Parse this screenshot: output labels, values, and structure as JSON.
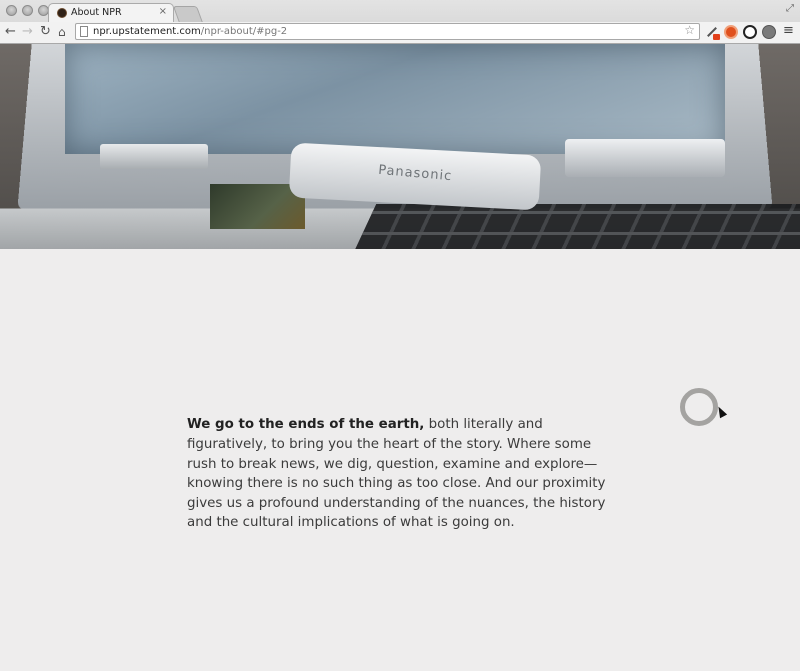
{
  "browser": {
    "tab_title": "About NPR",
    "tab_close": "×",
    "url_host": "npr.upstatement.com",
    "url_path": "/npr-about/#pg-2",
    "icons": {
      "back": "back-arrow-icon",
      "forward": "forward-arrow-icon",
      "reload": "reload-icon",
      "home": "home-icon",
      "star": "bookmark-star-icon",
      "menu": "menu-icon"
    },
    "glyphs": {
      "back": "←",
      "forward": "→",
      "reload": "↻",
      "home": "⌂",
      "star": "☆",
      "menu": "≡"
    }
  },
  "hero": {
    "brand_text": "Panasonic"
  },
  "content": {
    "lead_bold": "We go to the ends of the earth,",
    "body": " both literally and figuratively, to bring you the heart of the story. Where some rush to break news, we dig, question, examine and explore—knowing there is no such thing as too close. And our proximity gives us a profound understanding of the nuances, the history and the cultural implications of what is going on."
  },
  "colors": {
    "page_background": "#eeeded",
    "text": "#3b3b3b",
    "loader_ring": "#a4a3a1"
  }
}
